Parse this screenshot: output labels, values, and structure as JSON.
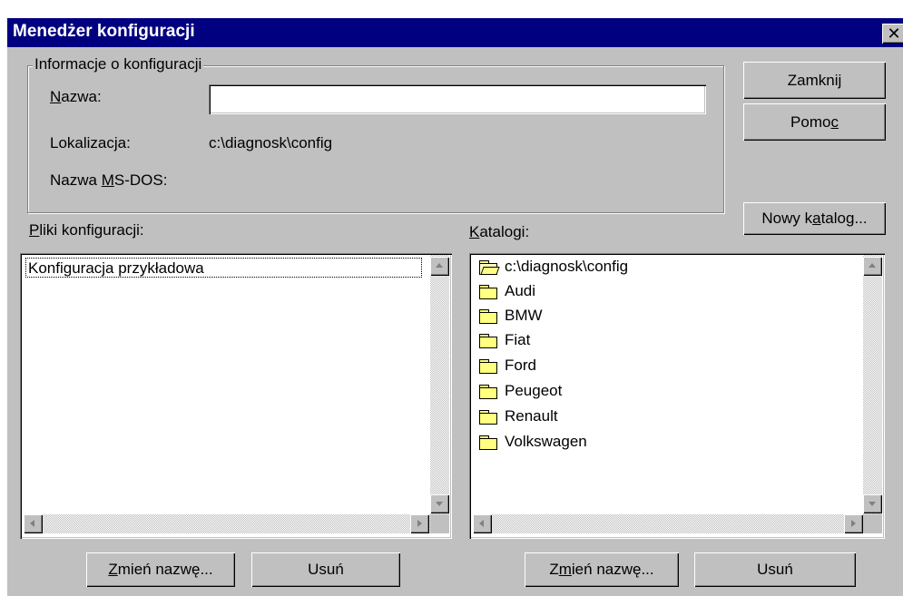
{
  "window": {
    "title": "Menedżer konfiguracji",
    "close_glyph": "✕"
  },
  "info_group": {
    "title": "Informacje o konfiguracji",
    "name_label_u": "N",
    "name_label_rest": "azwa:",
    "name_value": "",
    "location_label": "Lokalizacja:",
    "location_value": "c:\\diagnosk\\config",
    "msdos_label_pre": "Nazwa ",
    "msdos_label_u": "M",
    "msdos_label_rest": "S-DOS:",
    "msdos_value": ""
  },
  "buttons": {
    "close": "Zamknij",
    "help_pre": "Pomo",
    "help_u": "c",
    "new_folder_pre": "Nowy k",
    "new_folder_u": "a",
    "new_folder_rest": "talog...",
    "rename_files_u": "Z",
    "rename_files_rest": "mień nazwę...",
    "delete_files": "Usuń",
    "rename_folders_pre": "Z",
    "rename_folders_u": "m",
    "rename_folders_rest": "ień nazwę...",
    "delete_folders": "Usuń"
  },
  "config_files": {
    "label_u": "P",
    "label_rest": "liki konfiguracji:",
    "items": [
      "Konfiguracja przykładowa"
    ]
  },
  "folders": {
    "label_u": "K",
    "label_rest": "atalogi:",
    "root": "c:\\diagnosk\\config",
    "items": [
      "Audi",
      "BMW",
      "Fiat",
      "Ford",
      "Peugeot",
      "Renault",
      "Volkswagen"
    ]
  },
  "icons": {
    "open_folder": "open-folder-icon",
    "folder": "folder-icon"
  }
}
